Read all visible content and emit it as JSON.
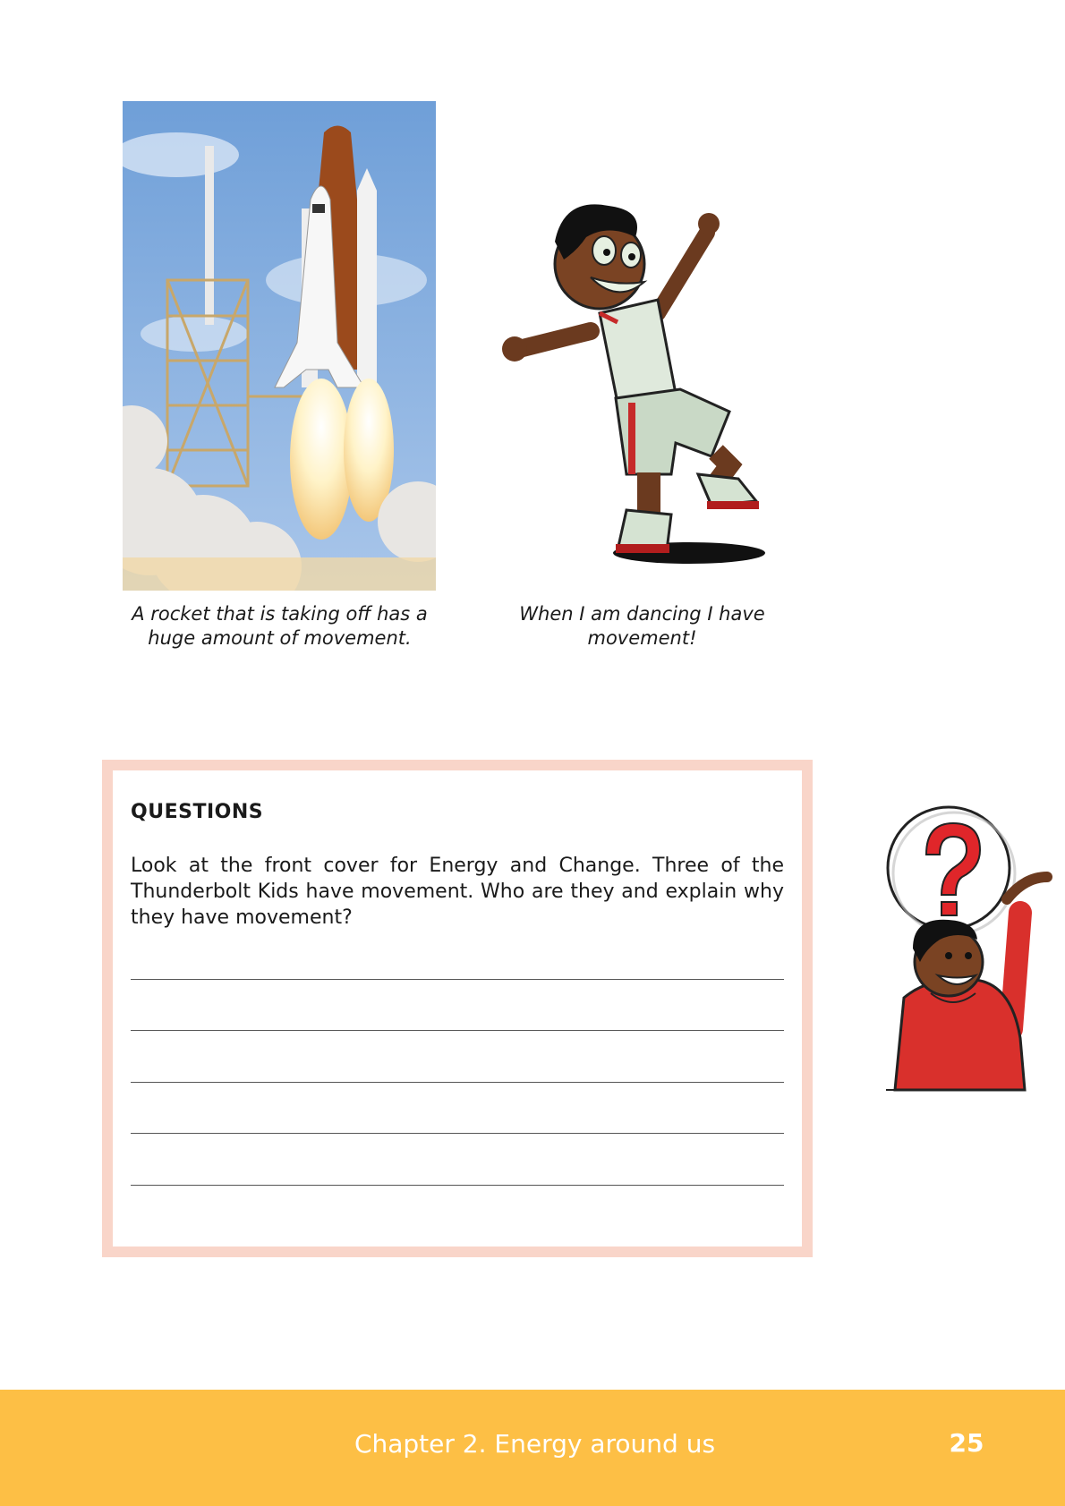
{
  "captions": {
    "rocket": "A rocket that is taking off has a\nhuge amount of movement.",
    "dancer": "When I am dancing I have\nmovement!"
  },
  "questions": {
    "title": "QUESTIONS",
    "text": "Look at the front cover for Energy and Change.  Three of the Thunderbolt Kids have movement.  Who are they and explain why they have movement?"
  },
  "footer": {
    "chapter": "Chapter 2.   Energy around us",
    "page_number": "25"
  },
  "colors": {
    "footer_bg": "#fdbf45",
    "box_border": "#f9d5c9",
    "jacket_red": "#d9302c"
  }
}
